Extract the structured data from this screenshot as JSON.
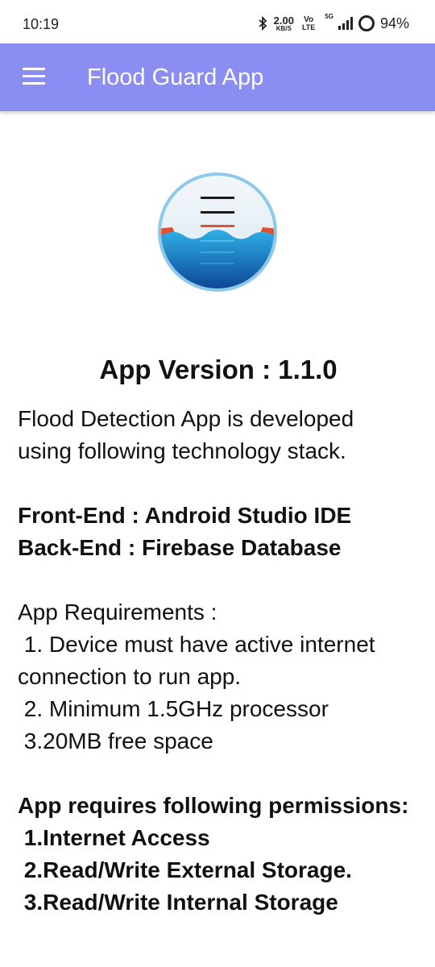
{
  "status_bar": {
    "time": "10:19",
    "net_speed_value": "2.00",
    "net_speed_unit": "KB/S",
    "volte_top": "Vo",
    "volte_bottom": "LTE",
    "network": "5G",
    "battery": "94%",
    "icons": [
      "bluetooth-icon",
      "signal-icon",
      "battery-icon"
    ]
  },
  "app_bar": {
    "title": "Flood Guard App",
    "menu_icon": "hamburger-menu-icon",
    "color": "#8a8ef2"
  },
  "logo": {
    "icon": "flood-gauge-logo-icon"
  },
  "content": {
    "version": "App Version : 1.1.0",
    "intro_line1": "Flood Detection App is developed",
    "intro_line2": "using following technology stack.",
    "frontend": "Front-End : Android Studio IDE",
    "backend": "Back-End : Firebase Database",
    "requirements_title": "App Requirements :",
    "req1_line1": " 1. Device must have active internet",
    "req1_line2": "connection to run app.",
    "req2": " 2. Minimum 1.5GHz processor",
    "req3": " 3.20MB free space",
    "permissions_title": "App requires following permissions:",
    "perm1": " 1.Internet Access",
    "perm2": " 2.Read/Write External Storage.",
    "perm3": " 3.Read/Write Internal Storage"
  }
}
